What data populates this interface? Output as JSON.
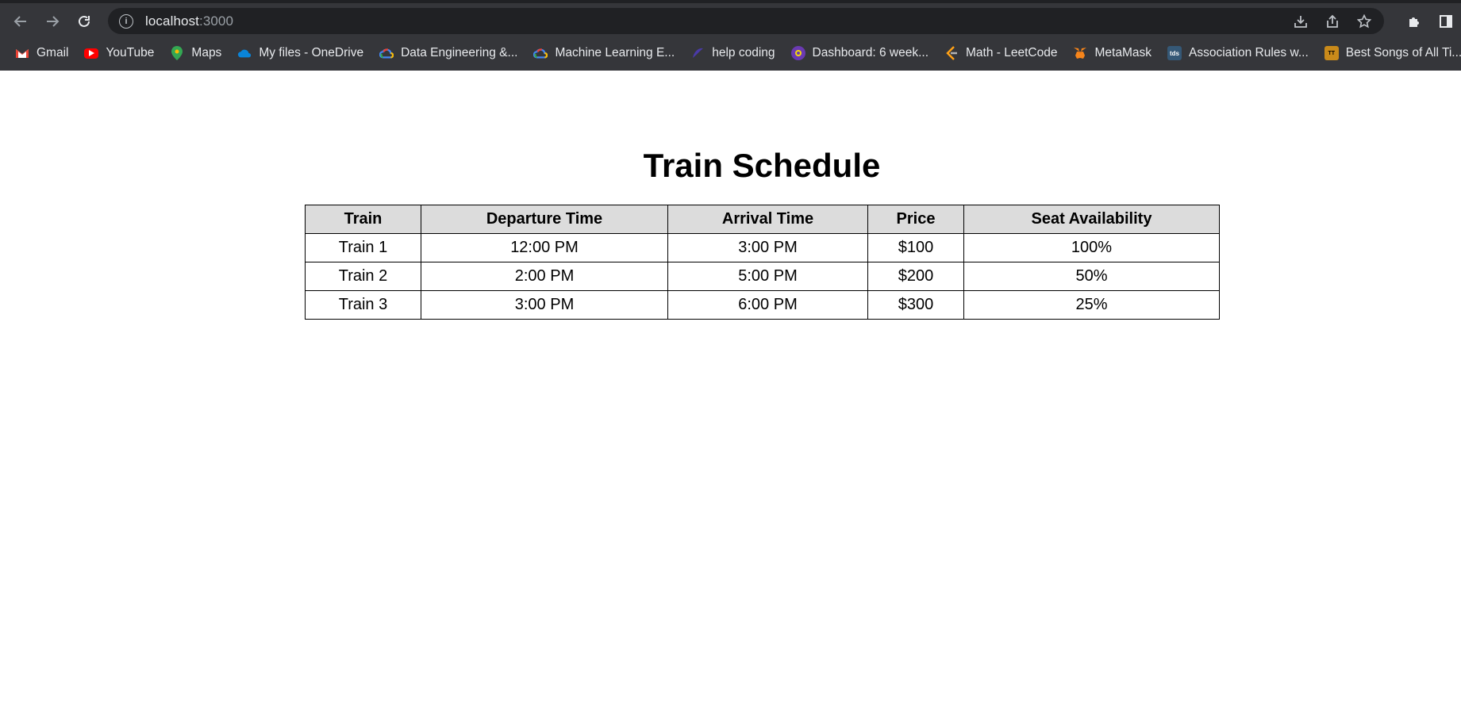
{
  "browser": {
    "url_host": "localhost",
    "url_port": ":3000",
    "bookmarks": [
      {
        "label": "Gmail",
        "icon": "gmail-icon",
        "color": "#ea4335"
      },
      {
        "label": "YouTube",
        "icon": "youtube-icon",
        "color": "#ff0000"
      },
      {
        "label": "Maps",
        "icon": "maps-icon",
        "color": "#34a853"
      },
      {
        "label": "My files - OneDrive",
        "icon": "onedrive-icon",
        "color": "#0a84d8"
      },
      {
        "label": "Data Engineering &...",
        "icon": "google-cloud-icon",
        "color": "#4285f4"
      },
      {
        "label": "Machine Learning E...",
        "icon": "google-cloud-icon",
        "color": "#4285f4"
      },
      {
        "label": "help coding",
        "icon": "help-coding-icon",
        "color": "#4a3aa8"
      },
      {
        "label": "Dashboard: 6 week...",
        "icon": "dashboard-icon",
        "color": "#6a3ab2"
      },
      {
        "label": "Math - LeetCode",
        "icon": "leetcode-icon",
        "color": "#ffa116"
      },
      {
        "label": "MetaMask",
        "icon": "metamask-icon",
        "color": "#f6851b"
      },
      {
        "label": "Association Rules w...",
        "icon": "tds-icon",
        "color": "#355876"
      },
      {
        "label": "Best Songs of All Ti...",
        "icon": "top-tens-icon",
        "color": "#c98a1a"
      }
    ]
  },
  "page": {
    "title": "Train Schedule",
    "table": {
      "headers": [
        "Train",
        "Departure Time",
        "Arrival Time",
        "Price",
        "Seat Availability"
      ],
      "rows": [
        [
          "Train 1",
          "12:00 PM",
          "3:00 PM",
          "$100",
          "100%"
        ],
        [
          "Train 2",
          "2:00 PM",
          "5:00 PM",
          "$200",
          "50%"
        ],
        [
          "Train 3",
          "3:00 PM",
          "6:00 PM",
          "$300",
          "25%"
        ]
      ]
    }
  }
}
